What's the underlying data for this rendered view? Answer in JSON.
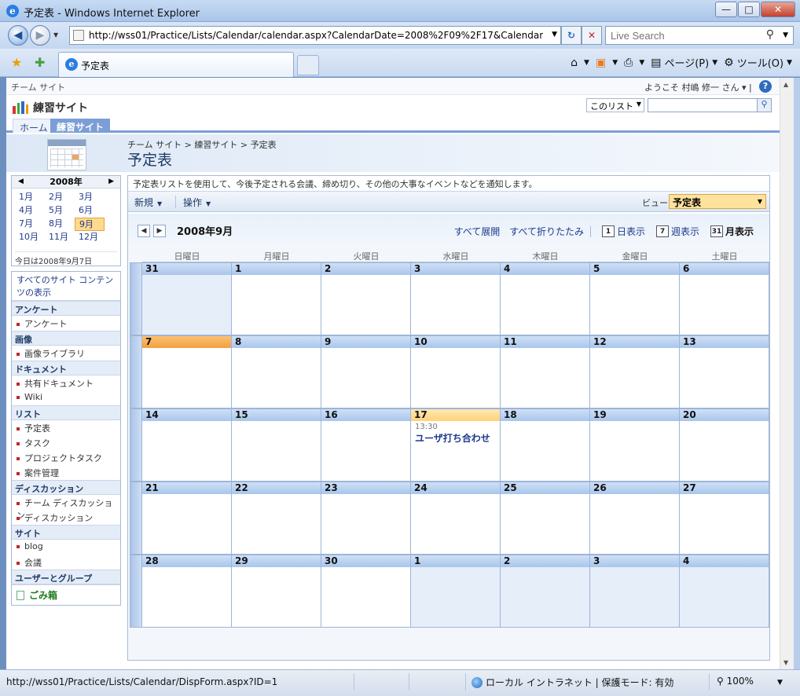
{
  "window": {
    "title": "予定表 - Windows Internet Explorer",
    "buttons": {
      "minimize": "—",
      "maximize": "□",
      "close": "✕"
    }
  },
  "address_bar": {
    "url": "http://wss01/Practice/Lists/Calendar/calendar.aspx?CalendarDate=2008%2F09%2F17&CalendarPer",
    "search_placeholder": "Live Search"
  },
  "tabs": [
    {
      "label": "予定表"
    }
  ],
  "command_bar": {
    "page": "ページ(P)",
    "tools": "ツール(O)"
  },
  "sharepoint": {
    "top_link": "チーム サイト",
    "welcome": "ようこそ 村嶋 修一 さん ▾ |",
    "site_title": "練習サイト",
    "search_scope": "このリスト",
    "top_nav": {
      "home": "ホーム",
      "current": "練習サイト"
    },
    "breadcrumb": "チーム サイト > 練習サイト > 予定表",
    "page_title": "予定表",
    "description": "予定表リストを使用して、今後予定される会議、締め切り、その他の大事なイベントなどを通知します。",
    "toolbar": {
      "new": "新規",
      "actions": "操作",
      "view_label": "ビュー:",
      "view_value": "予定表"
    }
  },
  "mini_calendar": {
    "year": "2008年",
    "months": [
      "1月",
      "2月",
      "3月",
      "4月",
      "5月",
      "6月",
      "7月",
      "8月",
      "9月",
      "10月",
      "11月",
      "12月"
    ],
    "today": "今日は2008年9月7日"
  },
  "quick_launch": {
    "all_content": "すべてのサイト コンテンツの表示",
    "sections": [
      {
        "heading": "アンケート",
        "items": [
          "アンケート"
        ]
      },
      {
        "heading": "画像",
        "items": [
          "画像ライブラリ"
        ]
      },
      {
        "heading": "ドキュメント",
        "items": [
          "共有ドキュメント",
          "Wiki"
        ]
      },
      {
        "heading": "リスト",
        "items": [
          "予定表",
          "タスク",
          "プロジェクトタスク",
          "案件管理"
        ]
      },
      {
        "heading": "ディスカッション",
        "items": [
          "チーム ディスカッション",
          "ディスカッション"
        ]
      },
      {
        "heading": "サイト",
        "items": [
          "blog",
          "会議"
        ]
      },
      {
        "heading": "ユーザーとグループ",
        "items": []
      }
    ],
    "recycle_bin": "ごみ箱"
  },
  "calendar": {
    "month_label": "2008年9月",
    "actions": {
      "expand": "すべて展開",
      "collapse": "すべて折りたたみ",
      "day": "日表示",
      "week": "週表示",
      "month": "月表示"
    },
    "view_icons": {
      "day": "1",
      "week": "7",
      "month": "31"
    },
    "weekdays": [
      "日曜日",
      "月曜日",
      "火曜日",
      "水曜日",
      "木曜日",
      "金曜日",
      "土曜日"
    ],
    "weeks": [
      [
        "31",
        "1",
        "2",
        "3",
        "4",
        "5",
        "6"
      ],
      [
        "7",
        "8",
        "9",
        "10",
        "11",
        "12",
        "13"
      ],
      [
        "14",
        "15",
        "16",
        "17",
        "18",
        "19",
        "20"
      ],
      [
        "21",
        "22",
        "23",
        "24",
        "25",
        "26",
        "27"
      ],
      [
        "28",
        "29",
        "30",
        "1",
        "2",
        "3",
        "4"
      ]
    ],
    "event": {
      "time": "13:30",
      "title": "ユーザ打ち合わせ"
    }
  },
  "status_bar": {
    "url": "http://wss01/Practice/Lists/Calendar/DispForm.aspx?ID=1",
    "zone": "ローカル イントラネット | 保護モード: 有効",
    "zoom": "100%"
  }
}
